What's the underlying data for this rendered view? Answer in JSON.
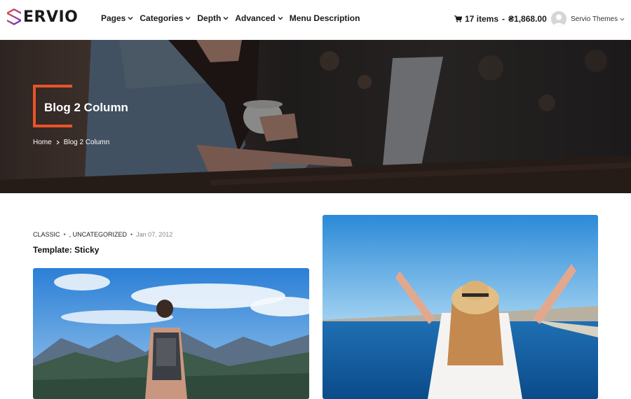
{
  "brand": {
    "name": "ERVIO",
    "accent": "#e8542a",
    "logo_gradient": [
      "#e8542a",
      "#6a2bd8"
    ]
  },
  "nav": {
    "items": [
      {
        "label": "Pages",
        "has_dropdown": true
      },
      {
        "label": "Categories",
        "has_dropdown": true
      },
      {
        "label": "Depth",
        "has_dropdown": true
      },
      {
        "label": "Advanced",
        "has_dropdown": true
      },
      {
        "label": "Menu Description",
        "has_dropdown": false
      }
    ]
  },
  "cart": {
    "icon": "cart-icon",
    "count_label": "17 items",
    "separator": "-",
    "total": "₴1,868.00"
  },
  "user": {
    "name": "Servio Themes",
    "icon": "avatar-icon"
  },
  "hero": {
    "title": "Blog 2 Column",
    "breadcrumb": [
      "Home",
      "Blog 2 Column"
    ]
  },
  "posts": [
    {
      "categories": [
        "CLASSIC",
        ", UNCATEGORIZED"
      ],
      "date": "Jan 07, 2012",
      "title": "Template: Sticky",
      "image": "hiker-mountains-photo"
    },
    {
      "image": "woman-beach-hat-photo"
    }
  ]
}
